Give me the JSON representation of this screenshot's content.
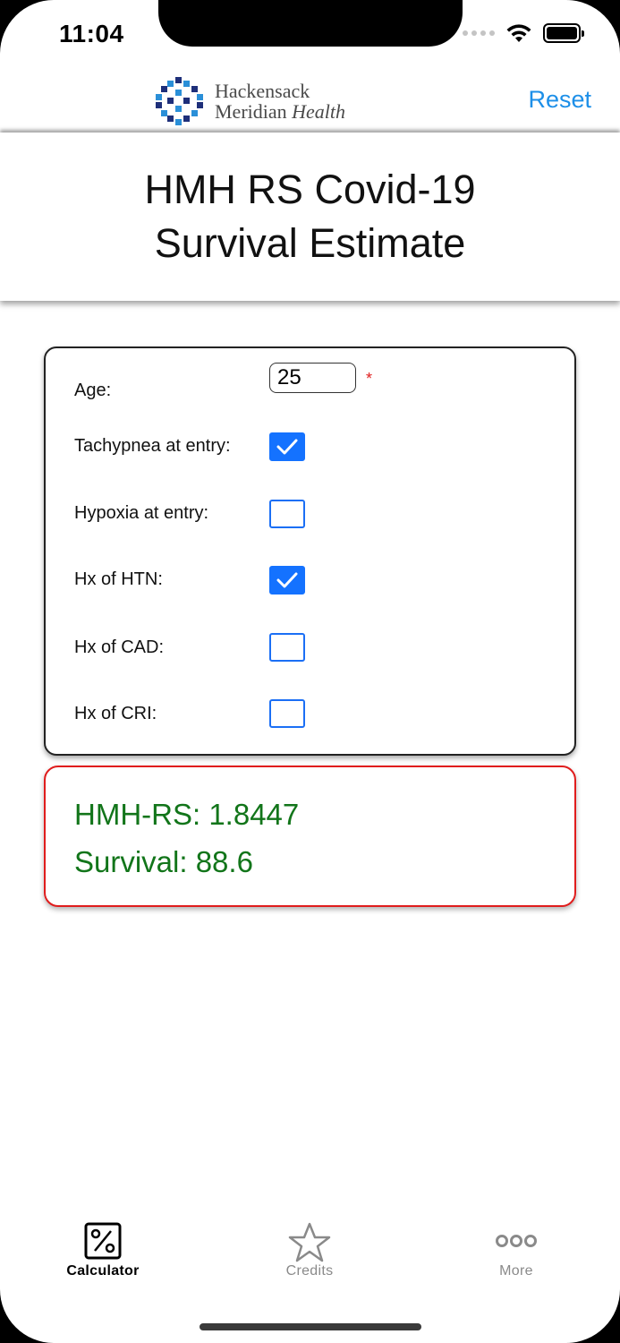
{
  "status_bar": {
    "time": "11:04"
  },
  "nav": {
    "logo_line1": "Hackensack",
    "logo_line2_a": "Meridian",
    "logo_line2_b": "Health",
    "reset_label": "Reset"
  },
  "header": {
    "title_line1": "HMH RS Covid-19",
    "title_line2": "Survival Estimate"
  },
  "form": {
    "age_label": "Age:",
    "age_value": "25",
    "required_mark": "*",
    "fields": [
      {
        "label": "Tachypnea at entry:",
        "checked": true
      },
      {
        "label": "Hypoxia at entry:",
        "checked": false
      },
      {
        "label": "Hx of HTN:",
        "checked": true
      },
      {
        "label": "Hx of CAD:",
        "checked": false
      },
      {
        "label": "Hx of CRI:",
        "checked": false
      }
    ]
  },
  "result": {
    "score_line": "HMH-RS: 1.8447",
    "survival_line": "Survival: 88.6"
  },
  "tabs": [
    {
      "label": "Calculator",
      "icon": "percent-icon",
      "active": true
    },
    {
      "label": "Credits",
      "icon": "star-icon",
      "active": false
    },
    {
      "label": "More",
      "icon": "more-dots-icon",
      "active": false
    }
  ],
  "colors": {
    "accent": "#1d8fe8",
    "checkbox": "#1472ff",
    "result_text": "#12751a",
    "result_border": "#e01d1d"
  }
}
